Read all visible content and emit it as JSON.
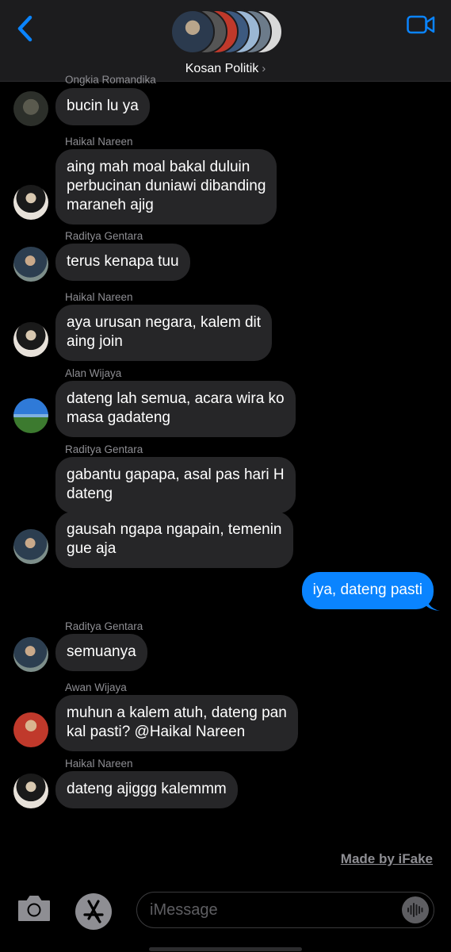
{
  "header": {
    "group_name": "Kosan Politik",
    "chevron": "›",
    "back_icon": "chevron-left-icon",
    "video_icon": "video-camera-icon",
    "accent_color": "#0a84ff"
  },
  "messages": [
    {
      "sender": "Ongkia Romandika",
      "text": "bucin lu ya"
    },
    {
      "sender": "Haikal Nareen",
      "lines": [
        "aing mah moal bakal duluin",
        "perbucinan duniawi dibanding",
        "maraneh ajig"
      ]
    },
    {
      "sender": "Raditya Gentara",
      "text": "terus kenapa tuu"
    },
    {
      "sender": "Haikal Nareen",
      "lines": [
        "aya urusan negara, kalem dit",
        "aing join"
      ]
    },
    {
      "sender": "Alan Wijaya",
      "lines": [
        "dateng lah semua, acara wira ko",
        "masa gadateng"
      ]
    },
    {
      "sender": "Raditya Gentara",
      "lines": [
        "gabantu gapapa, asal pas hari H",
        "dateng"
      ]
    },
    {
      "lines": [
        "gausah ngapa ngapain, temenin",
        "gue aja"
      ]
    },
    {
      "outgoing": true,
      "text": "iya, dateng pasti"
    },
    {
      "sender": "Raditya Gentara",
      "text": "semuanya"
    },
    {
      "sender": "Awan Wijaya",
      "lines": [
        "muhun a kalem atuh, dateng pan",
        "kal pasti? @Haikal Nareen"
      ]
    },
    {
      "sender": "Haikal Nareen",
      "text": "dateng ajiggg kalemmm"
    }
  ],
  "watermark": "Made by iFake",
  "composer": {
    "placeholder": "iMessage",
    "camera_icon": "camera-icon",
    "apps_icon": "app-store-icon",
    "audio_icon": "audio-waveform-icon"
  }
}
